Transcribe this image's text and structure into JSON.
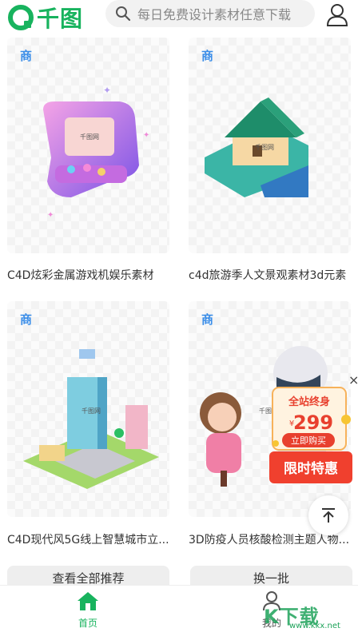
{
  "header": {
    "logo_text": "千图",
    "search_placeholder": "每日免费设计素材任意下载"
  },
  "cards": [
    {
      "badge": "商",
      "caption": "C4D炫彩金属游戏机娱乐素材",
      "art_watermark": "千图网"
    },
    {
      "badge": "商",
      "caption": "c4d旅游季人文景观素材3d元素",
      "art_watermark": "千图网"
    },
    {
      "badge": "商",
      "caption": "C4D现代风5G线上智慧城市立...",
      "art_watermark": "千图网"
    },
    {
      "badge": "商",
      "caption": "3D防疫人员核酸检测主题人物...",
      "art_watermark": "千图网"
    }
  ],
  "buttons": {
    "view_all": "查看全部推荐",
    "refresh": "换一批"
  },
  "promo": {
    "line1": "全站终身",
    "currency": "¥",
    "price": "299",
    "buy": "立即购买",
    "offer": "限时特惠",
    "close": "×"
  },
  "tabbar": {
    "home": "首页",
    "mine": "我的"
  },
  "overlay": {
    "watermark": "K下载",
    "url": "www.kkx.net"
  },
  "colors": {
    "brand_green": "#18b35e",
    "badge_blue": "#3a8de8",
    "promo_red": "#f0402e"
  }
}
